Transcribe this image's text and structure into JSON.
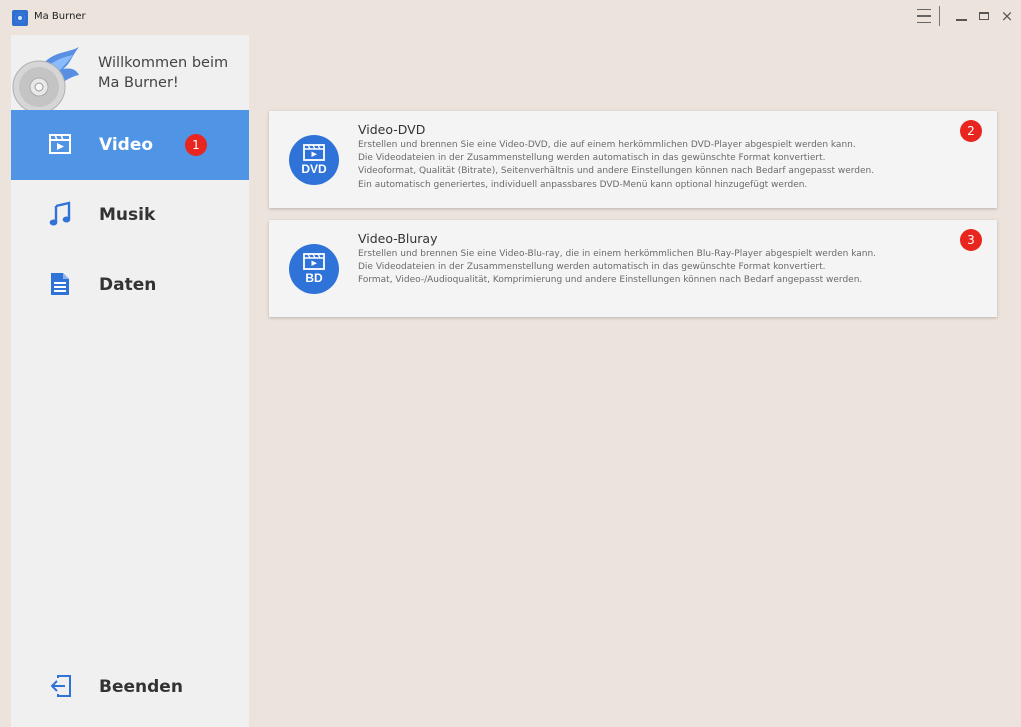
{
  "window": {
    "title": "Ma Burner",
    "controls": {
      "menu_icon": "hamburger-menu-icon",
      "minimize_icon": "minimize-icon",
      "maximize_icon": "maximize-icon",
      "close_symbol": "×"
    }
  },
  "sidebar": {
    "welcome_line1": "Willkommen beim",
    "welcome_line2": "Ma Burner!",
    "items": [
      {
        "label": "Video",
        "icon": "video-icon",
        "active": true,
        "badge": "1"
      },
      {
        "label": "Musik",
        "icon": "music-note-icon",
        "active": false
      },
      {
        "label": "Daten",
        "icon": "document-icon",
        "active": false
      }
    ],
    "exit_label": "Beenden",
    "exit_icon": "exit-icon"
  },
  "cards": [
    {
      "title": "Video-DVD",
      "icon_label": "DVD",
      "badge": "2",
      "lines": [
        "Erstellen und brennen Sie eine Video-DVD, die auf einem herkömmlichen DVD-Player abgespielt werden kann.",
        "Die Videodateien in der Zusammenstellung  werden automatisch in das gewünschte Format konvertiert.",
        "Videoformat, Qualität (Bitrate), Seitenverhältnis und andere Einstellungen können nach Bedarf angepasst werden.",
        "Ein automatisch generiertes, individuell anpassbares DVD-Menü kann optional hinzugefügt werden."
      ]
    },
    {
      "title": "Video-Bluray",
      "icon_label": "BD",
      "badge": "3",
      "lines": [
        "Erstellen und brennen Sie eine Video-Blu-ray, die in einem herkömmlichen Blu-Ray-Player abgespielt werden kann.",
        "Die Videodateien in der Zusammenstellung werden automatisch in das gewünschte Format konvertiert.",
        "Format, Video-/Audioqualität, Komprimierung und andere Einstellungen können nach Bedarf angepasst werden."
      ]
    }
  ],
  "colors": {
    "background": "#ece3dc",
    "sidebar": "#f0f0f0",
    "active_nav": "#5094e6",
    "accent_icon": "#2f72d8",
    "badge": "#e8261f"
  }
}
